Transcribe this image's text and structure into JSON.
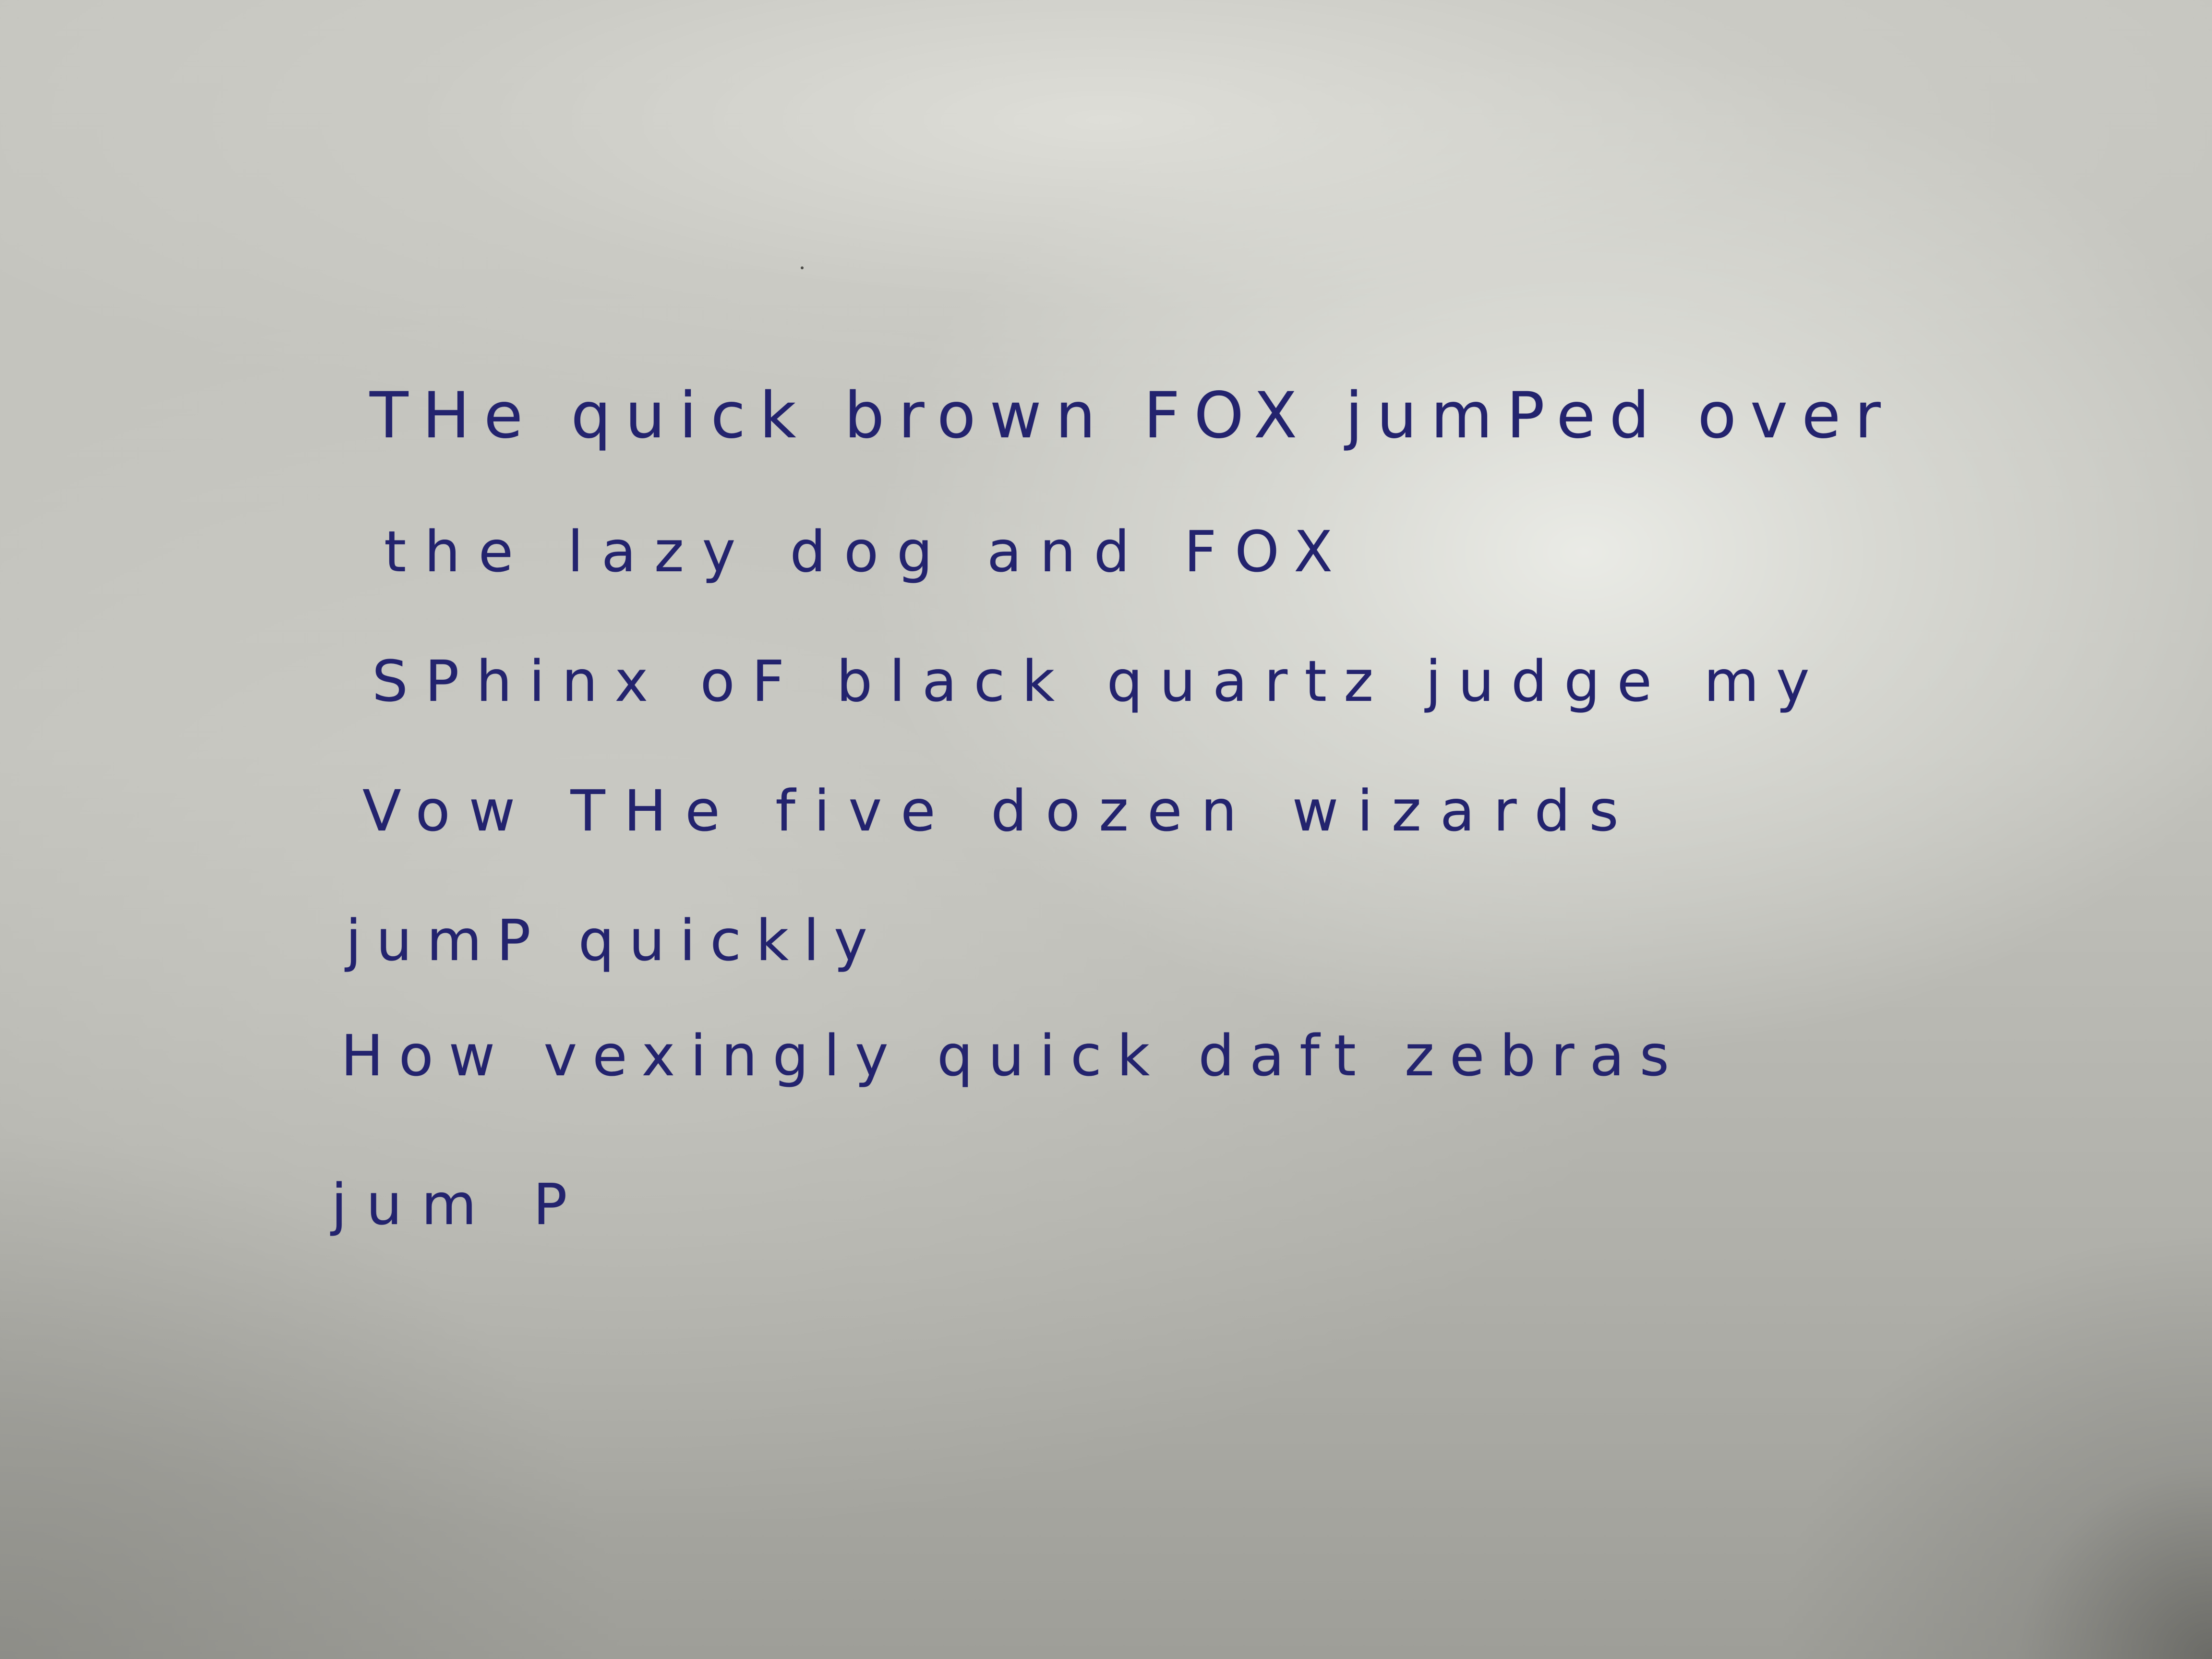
{
  "handwritten_lines": [
    "THe quick brown FOX jumPed over",
    "the lazy dog and FOX",
    "SPhinx oF black quartz judge my",
    "Vow  THe five dozen wizards",
    "jumP quickly",
    "How vexingly quick daft zebras",
    "jum P"
  ],
  "ink_color": "#23236e",
  "paper_color": "#c6c6c0"
}
